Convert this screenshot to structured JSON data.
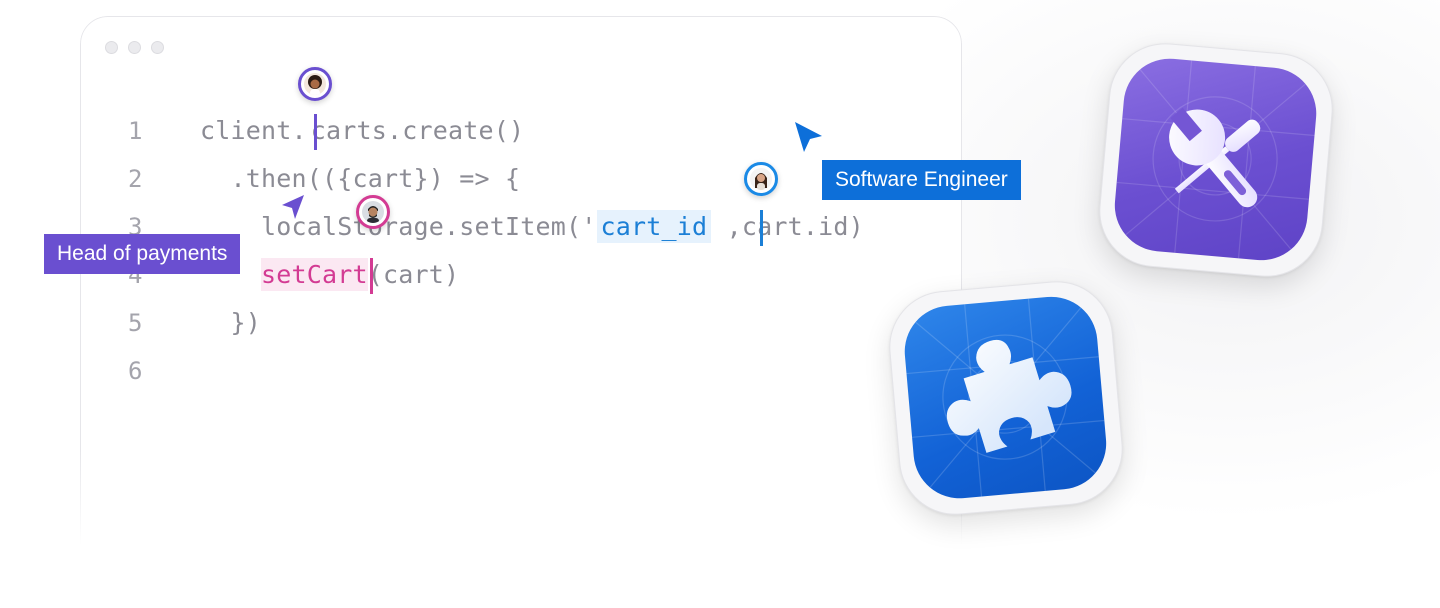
{
  "window": {
    "controls": [
      "close",
      "minimize",
      "zoom"
    ]
  },
  "code": {
    "lines": [
      {
        "number": "1",
        "parts": [
          "client.",
          "carts.create()"
        ]
      },
      {
        "number": "2",
        "parts": [
          "  .then(({cart}) => {"
        ]
      },
      {
        "number": "3",
        "parts": [
          "    localStorage.setItem('",
          "cart_id",
          " ,cart.id)"
        ]
      },
      {
        "number": "4",
        "parts": [
          "    ",
          "setCart",
          "(cart)"
        ]
      },
      {
        "number": "5",
        "parts": [
          "  })"
        ]
      },
      {
        "number": "6",
        "parts": [
          ""
        ]
      }
    ]
  },
  "collaborators": {
    "head_of_payments": {
      "label": "Head of payments",
      "color": "#6a4fd0"
    },
    "software_engineer": {
      "label": "Software Engineer",
      "color": "#0d6fd9"
    },
    "line4_editor": {
      "color": "#d33b93"
    },
    "line1_editor": {
      "color": "#6a4fd0"
    }
  },
  "icons": {
    "tools_app": "tools-app-icon",
    "puzzle_app": "puzzle-app-icon"
  }
}
